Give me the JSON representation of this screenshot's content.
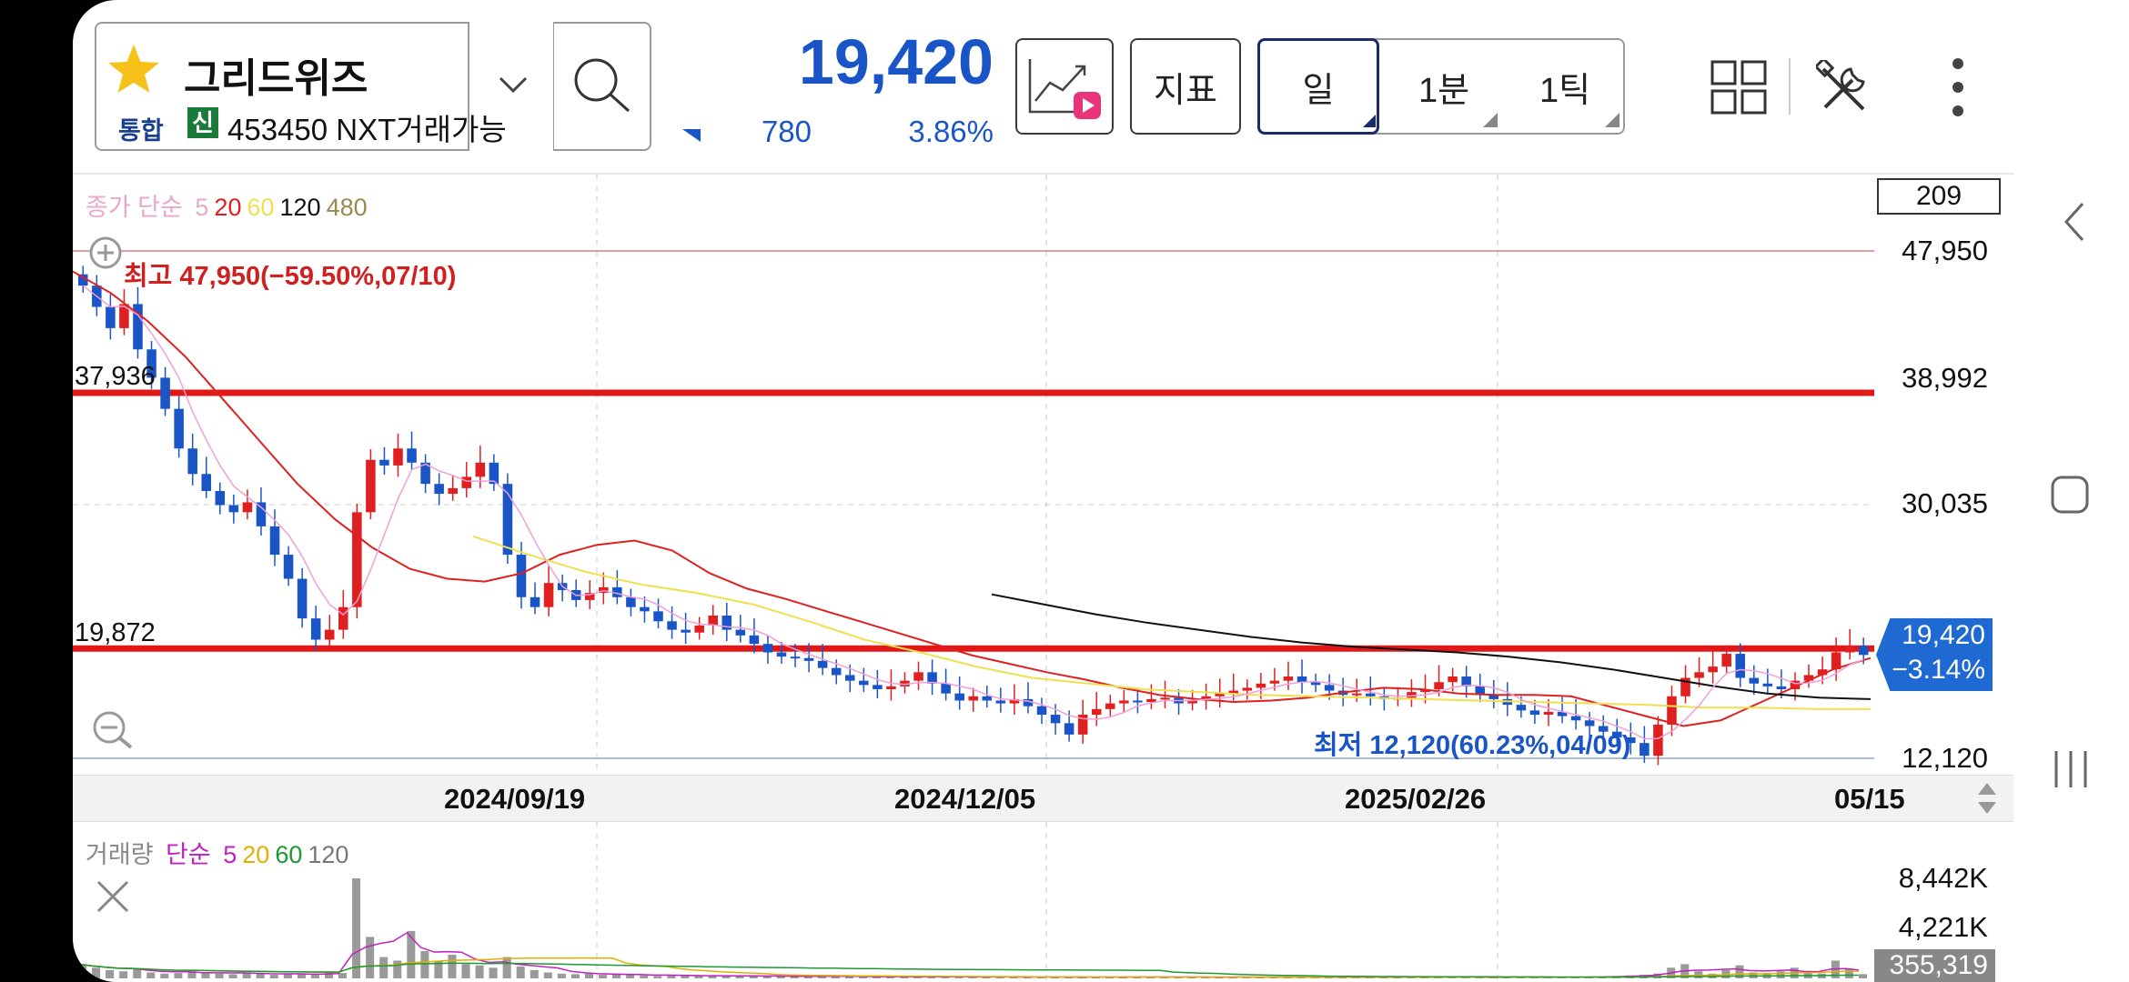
{
  "stock": {
    "name": "그리드위즈",
    "market_tag": "통합",
    "credit_tag": "신",
    "code_line": "453450 NXT거래가능",
    "price": "19,420",
    "change": "780",
    "change_pct": "3.86%"
  },
  "toolbar": {
    "indicator_label": "지표",
    "period_tabs": [
      "일",
      "1분",
      "1틱"
    ],
    "active_period": "일"
  },
  "colors": {
    "price_down": "#1a55c8",
    "price_up": "#e02020",
    "ma5": "#f0a0d8",
    "ma20": "#e02020",
    "ma60": "#f0e050",
    "ma120": "#111111",
    "ma480": "#9a8a50",
    "vol_ma5": "#c020c0",
    "vol_ma20": "#e0b000",
    "vol_ma60": "#1a9a30",
    "vol_ma120": "#777777"
  },
  "price_panel": {
    "legend": {
      "label": "종가 단순",
      "ma": [
        "5",
        "20",
        "60",
        "120",
        "480"
      ]
    },
    "count_box": "209",
    "high_annotation": "최고 47,950(−59.50%,07/10)",
    "low_annotation": "최저 12,120(60.23%,04/09)",
    "left_levels": [
      "37,936",
      "19,872"
    ],
    "right_ticks": [
      "47,950",
      "38,992",
      "30,035",
      "12,120"
    ],
    "current_tag": {
      "price": "19,420",
      "pct": "−3.14%"
    }
  },
  "x_axis_labels": [
    "2024/09/19",
    "2024/12/05",
    "2025/02/26",
    "05/15"
  ],
  "volume_panel": {
    "legend": {
      "label": "거래량",
      "type": "단순",
      "ma": [
        "5",
        "20",
        "60",
        "120"
      ]
    },
    "right_ticks": [
      "8,442K",
      "4,221K"
    ],
    "current": "355,319"
  },
  "chart_data": {
    "type": "candlestick",
    "title": "",
    "x_start": "2024/07/10",
    "x_end": "2025/05/15",
    "date_ticks": [
      "2024/09/19",
      "2024/12/05",
      "2025/02/26",
      "05/15"
    ],
    "ylim": [
      12120,
      47950
    ],
    "y_ticks": [
      47950,
      38992,
      30035,
      12120
    ],
    "horizontal_levels": [
      37936,
      19872
    ],
    "high": {
      "value": 47950,
      "pct": -59.5,
      "date": "07/10"
    },
    "low": {
      "value": 12120,
      "pct": 60.23,
      "date": "04/09"
    },
    "close_series": [
      45500,
      44000,
      42500,
      44200,
      41000,
      39000,
      36800,
      34000,
      32200,
      31000,
      30000,
      29500,
      30200,
      28500,
      26500,
      24800,
      22000,
      20500,
      21200,
      22800,
      29500,
      33200,
      32800,
      34000,
      33000,
      31500,
      30800,
      31200,
      32000,
      33000,
      31500,
      26500,
      23500,
      22800,
      24500,
      24000,
      23300,
      23800,
      24200,
      23500,
      22800,
      22500,
      21800,
      21200,
      21000,
      21500,
      22200,
      21200,
      20800,
      20200,
      19600,
      19300,
      19200,
      19000,
      18500,
      18000,
      17600,
      17300,
      17000,
      17200,
      17600,
      18200,
      17400,
      16700,
      16200,
      16500,
      16200,
      16000,
      16300,
      15800,
      15200,
      14600,
      13800,
      15200,
      15600,
      16000,
      16200,
      16100,
      16300,
      16400,
      16000,
      16200,
      16500,
      16700,
      16900,
      17100,
      17400,
      17600,
      17900,
      17500,
      17300,
      16900,
      16600,
      16700,
      16500,
      16300,
      16400,
      16800,
      17000,
      17500,
      17900,
      17200,
      16600,
      16300,
      15900,
      15500,
      15200,
      15400,
      15100,
      14800,
      14400,
      14000,
      13600,
      13200,
      12300,
      14500,
      16500,
      17800,
      18200,
      18600,
      19500,
      17800,
      17400,
      17200,
      17000,
      17600,
      18000,
      18400,
      19600,
      20050,
      19420
    ],
    "ma_series": [
      {
        "name": "20",
        "values": [
          46500,
          45000,
          43000,
          40500,
          37500,
          34500,
          31500,
          29000,
          27000,
          25500,
          24800,
          24600,
          25200,
          26500,
          27200,
          27500,
          26800,
          25200,
          24100,
          23400,
          22600,
          21800,
          21000,
          20200,
          19400,
          18800,
          18200,
          17700,
          17100,
          16600,
          16300,
          16100,
          16200,
          16400,
          16800,
          17100,
          17000,
          16700,
          16600,
          16600,
          16500,
          15800,
          15100,
          14400,
          14800,
          16000,
          17200,
          18400,
          19200
        ]
      },
      {
        "name": "60",
        "values": [
          27800,
          26500,
          25300,
          24400,
          23800,
          23000,
          21800,
          20500,
          19600,
          18600,
          17800,
          17400,
          17000,
          16800,
          16600,
          16500,
          16400,
          16300,
          16200,
          16100,
          16000,
          15900,
          15700,
          15700,
          15600,
          15600
        ]
      },
      {
        "name": "120",
        "values": [
          23700,
          23000,
          22300,
          21700,
          21200,
          20700,
          20300,
          20000,
          19800,
          19600,
          19300,
          18900,
          18400,
          17800,
          17200,
          16700,
          16400,
          16300
        ]
      }
    ],
    "volume": {
      "y_ticks_k": [
        8442,
        4221
      ],
      "current": 355319,
      "values_k": [
        1200,
        900,
        700,
        600,
        800,
        500,
        400,
        450,
        600,
        500,
        400,
        350,
        500,
        400,
        300,
        350,
        400,
        300,
        500,
        450,
        8442,
        3500,
        1800,
        1500,
        4000,
        2300,
        1500,
        2000,
        1200,
        1100,
        900,
        1800,
        1000,
        700,
        500,
        400,
        350,
        400,
        300,
        350,
        300,
        250,
        200,
        300,
        250,
        200,
        180,
        200,
        250,
        200,
        180,
        160,
        150,
        200,
        180,
        160,
        150,
        140,
        130,
        150,
        140,
        130,
        120,
        140,
        130,
        120,
        110,
        130,
        120,
        110,
        100,
        120,
        110,
        100,
        120,
        110,
        100,
        130,
        120,
        110,
        100,
        120,
        110,
        100,
        110,
        120,
        100,
        90,
        100,
        110,
        100,
        90,
        100,
        110,
        100,
        90,
        100,
        110,
        100,
        90,
        80,
        100,
        90,
        80,
        90,
        100,
        90,
        80,
        90,
        100,
        120,
        150,
        200,
        250,
        300,
        400,
        900,
        1200,
        600,
        400,
        700,
        1100,
        500,
        400,
        600,
        900,
        500,
        400,
        1500,
        800,
        355
      ]
    }
  }
}
